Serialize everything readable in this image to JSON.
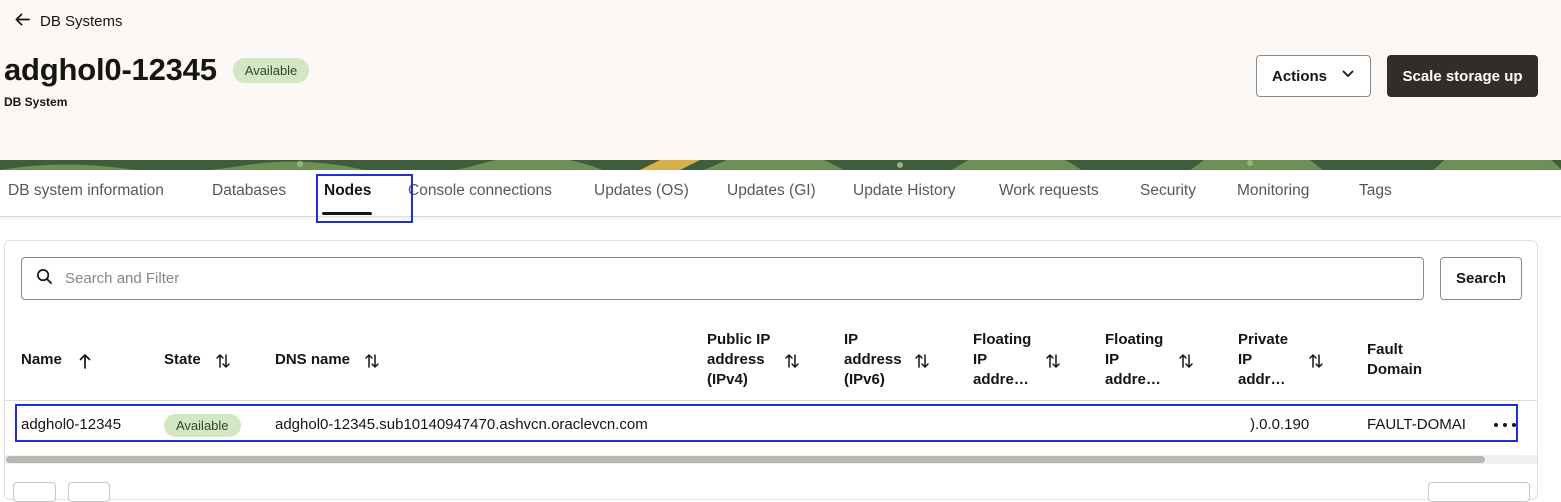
{
  "nav": {
    "back_label": "DB Systems"
  },
  "page": {
    "title": "adghol0-12345",
    "status": "Available",
    "subtitle": "DB System"
  },
  "toolbar": {
    "actions_label": "Actions",
    "primary_label": "Scale storage up"
  },
  "tabs": [
    {
      "label": "DB system information"
    },
    {
      "label": "Databases"
    },
    {
      "label": "Nodes",
      "active": true
    },
    {
      "label": "Console connections"
    },
    {
      "label": "Updates (OS)"
    },
    {
      "label": "Updates (GI)"
    },
    {
      "label": "Update History"
    },
    {
      "label": "Work requests"
    },
    {
      "label": "Security"
    },
    {
      "label": "Monitoring"
    },
    {
      "label": "Tags"
    }
  ],
  "search": {
    "placeholder": "Search and Filter",
    "button_label": "Search"
  },
  "table": {
    "columns": [
      {
        "lines": [
          "Name"
        ]
      },
      {
        "lines": [
          "State"
        ]
      },
      {
        "lines": [
          "DNS name"
        ]
      },
      {
        "lines": [
          "Public IP",
          "address",
          "(IPv4)"
        ]
      },
      {
        "lines": [
          "IP",
          "address",
          "(IPv6)"
        ]
      },
      {
        "lines": [
          "Floating",
          "IP",
          "addre…"
        ]
      },
      {
        "lines": [
          "Floating",
          "IP",
          "addre…"
        ]
      },
      {
        "lines": [
          "Private",
          "IP",
          "addr…"
        ]
      },
      {
        "lines": [
          "Fault",
          "Domain"
        ]
      }
    ],
    "rows": [
      {
        "name": "adghol0-12345",
        "state": "Available",
        "dns": "adghol0-12345.sub10140947470.ashvcn.oraclevcn.com",
        "private_ip": ").0.0.190",
        "fault_domain": "FAULT-DOMAI"
      }
    ]
  },
  "colors": {
    "highlight": "#1f2fd6",
    "badge_bg": "#d4e7c5",
    "primary_button": "#312d2a"
  },
  "icons": [
    "arrow-left-icon",
    "chevron-down-icon",
    "search-icon",
    "sort-icon",
    "sort-up-icon",
    "more-icon"
  ]
}
